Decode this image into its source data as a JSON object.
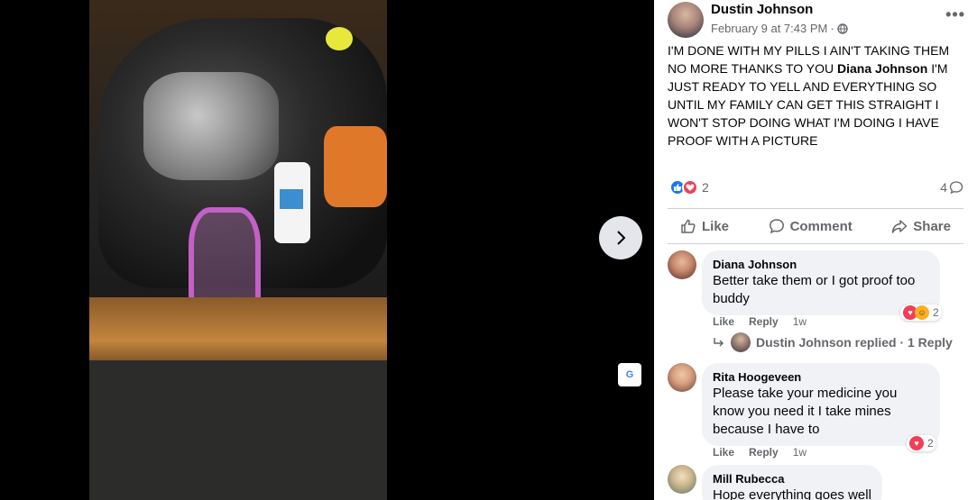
{
  "post": {
    "author": "Dustin Johnson",
    "date": "February 9 at 7:43 PM",
    "separator": "·",
    "text_before": "I'M DONE WITH MY PILLS I AIN'T TAKING THEM NO MORE THANKS TO YOU ",
    "mention": "Diana Johnson",
    "text_after": " I'M JUST READY TO YELL AND EVERYTHING SO UNTIL MY FAMILY CAN GET THIS STRAIGHT I WON'T STOP DOING WHAT I'M DOING I HAVE PROOF WITH A PICTURE",
    "reaction_count": "2",
    "comment_count": "4",
    "more_label": "•••"
  },
  "actions": {
    "like": "Like",
    "comment": "Comment",
    "share": "Share"
  },
  "comments": [
    {
      "name": "Diana Johnson",
      "text": "Better take them or I got proof too buddy",
      "like": "Like",
      "reply": "Reply",
      "time": "1w",
      "reaction_count": "2",
      "replies": "Dustin Johnson replied · 1 Reply"
    },
    {
      "name": "Rita Hoogeveen",
      "text": "Please take your medicine you know you need it I take mines because I have to",
      "like": "Like",
      "reply": "Reply",
      "time": "1w",
      "reaction_count": "2"
    },
    {
      "name": "Mill Rubecca",
      "text": "Hope everything goes well"
    }
  ],
  "translate_label": "G",
  "colors": {
    "like_blue": "#1877f2",
    "love_red": "#f33e58",
    "secondary_text": "#65676b",
    "bubble_bg": "#f0f2f5"
  }
}
